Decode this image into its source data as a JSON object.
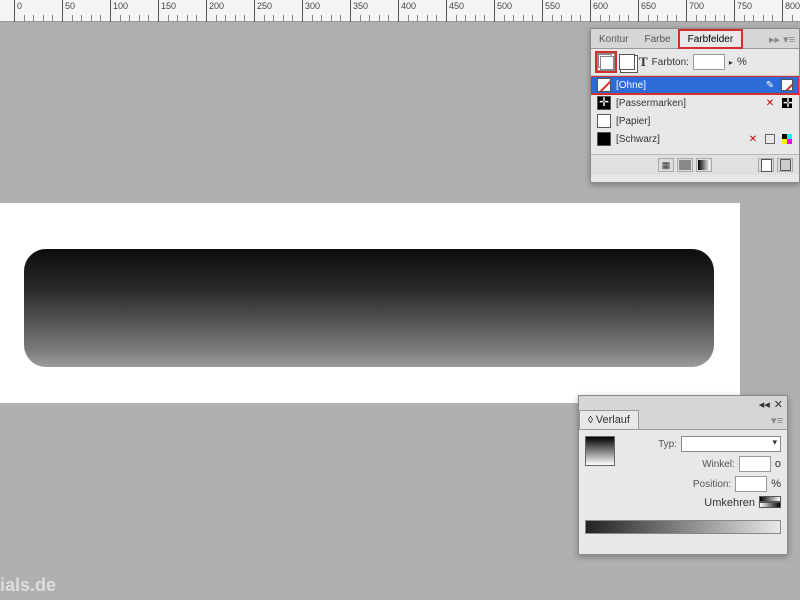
{
  "ruler": {
    "ticks": [
      0,
      50,
      100,
      150,
      200,
      250,
      300,
      350,
      400,
      450,
      500,
      550,
      600,
      650,
      700,
      750,
      800
    ]
  },
  "swatches_panel": {
    "tabs": [
      {
        "label": "Kontur"
      },
      {
        "label": "Farbe"
      },
      {
        "label": "Farbfelder"
      }
    ],
    "tint_label": "Farbton:",
    "tint_unit": "%",
    "items": [
      {
        "name": "[Ohne]",
        "type": "none",
        "selected": true
      },
      {
        "name": "[Passermarken]",
        "type": "reg"
      },
      {
        "name": "[Papier]",
        "type": "paper"
      },
      {
        "name": "[Schwarz]",
        "type": "black"
      }
    ]
  },
  "gradient_panel": {
    "title": "Verlauf",
    "type_label": "Typ:",
    "angle_label": "Winkel:",
    "angle_unit": "o",
    "position_label": "Position:",
    "position_unit": "%",
    "reverse_label": "Umkehren"
  },
  "watermark": "ials.de"
}
